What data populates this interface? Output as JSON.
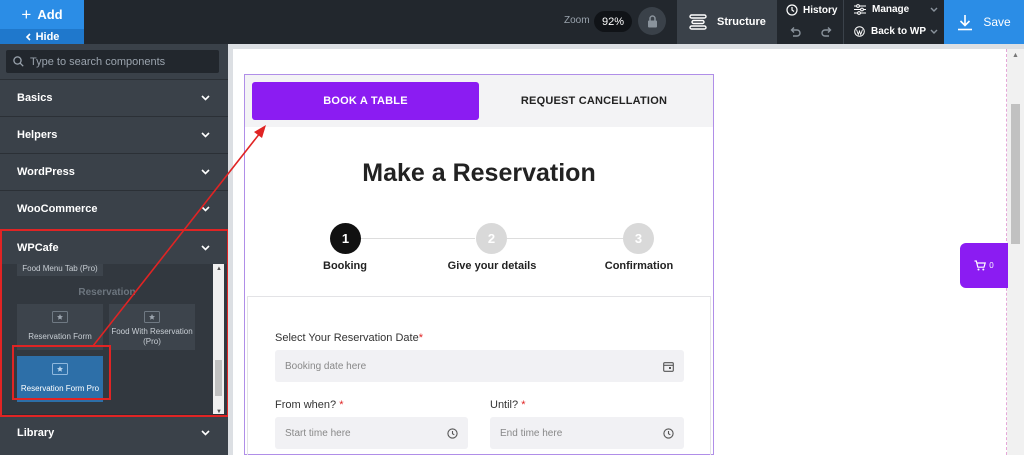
{
  "topbar": {
    "add_label": "Add",
    "hide_label": "Hide",
    "zoom_label": "Zoom",
    "zoom_value": "92%",
    "structure_label": "Structure",
    "history_label": "History",
    "manage_label": "Manage",
    "back_to_wp_label": "Back to WP",
    "save_label": "Save"
  },
  "sidebar": {
    "search_placeholder": "Type to search components",
    "categories": [
      "Basics",
      "Helpers",
      "WordPress",
      "WooCommerce",
      "WPCafe",
      "Library"
    ],
    "wpcafe": {
      "partial_tile": "Food Menu Tab (Pro)",
      "group_label": "Reservation",
      "tiles": [
        "Reservation Form",
        "Food With Reservation (Pro)",
        "Reservation Form Pro"
      ]
    }
  },
  "widget": {
    "tabs": [
      "BOOK A TABLE",
      "REQUEST CANCELLATION"
    ],
    "title": "Make a Reservation",
    "steps": [
      {
        "number": "1",
        "label": "Booking"
      },
      {
        "number": "2",
        "label": "Give your details"
      },
      {
        "number": "3",
        "label": "Confirmation"
      }
    ],
    "form": {
      "date_label": "Select Your Reservation Date",
      "date_placeholder": "Booking date here",
      "from_label": "From when?",
      "from_placeholder": "Start time here",
      "until_label": "Until?",
      "until_placeholder": "End time here",
      "required_mark": "*"
    }
  },
  "cart": {
    "count": "0"
  },
  "colors": {
    "brand_blue": "#2b8de6",
    "accent_purple": "#8b1cf2",
    "highlight_red": "#e02424",
    "topbar_bg": "#22272d",
    "sidebar_bg": "#3a4149"
  }
}
